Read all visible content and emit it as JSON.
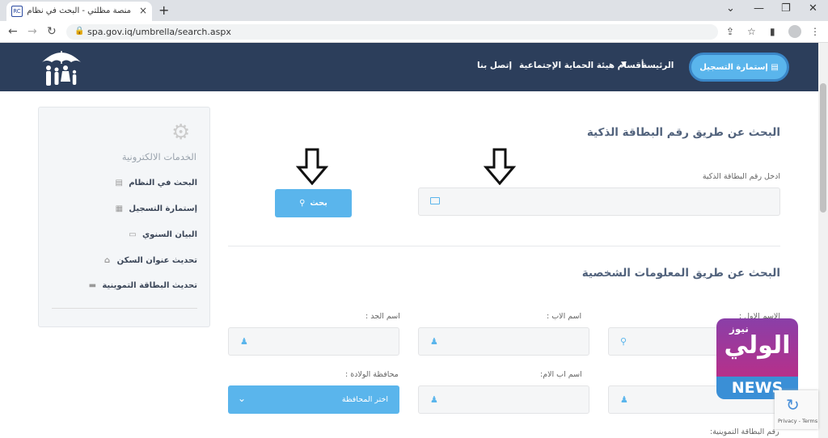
{
  "browser": {
    "tab_title": "منصة مظلتي - البحث في نظام هيئة الحماية",
    "tab_favicon_text": "RC",
    "tab_close": "×",
    "new_tab": "+",
    "url": "spa.gov.iq/umbrella/search.aspx",
    "window_controls": [
      "⌄",
      "—",
      "❐",
      "✕"
    ]
  },
  "header": {
    "menu": {
      "home": "الرئيسة",
      "departments": "أقسام هيئة الحماية الإجتماعية",
      "contact": "إتصل بنا"
    },
    "register_button": "إستمارة التسجيل"
  },
  "sidebar": {
    "title": "الخدمات الالكترونية",
    "items": [
      {
        "label": "البحث في النظام",
        "icon": "database-icon"
      },
      {
        "label": "إستمارة التسجيل",
        "icon": "file-icon"
      },
      {
        "label": "البيان السنوي",
        "icon": "id-card-icon"
      },
      {
        "label": "تحديث عنوان السكن",
        "icon": "home-icon"
      },
      {
        "label": "تحديث البطاقة التموينية",
        "icon": "credit-card-icon"
      }
    ]
  },
  "smart_card_search": {
    "heading": "البحث عن طريق رقم البطاقة الذكية",
    "input_label": "ادخل رقم البطاقة الذكية",
    "search_button": "بحث"
  },
  "personal_info_search": {
    "heading": "البحث عن طريق المعلومات الشخصية",
    "labels": {
      "first_name": "الاسم الاول :",
      "father_name": "اسم الاب :",
      "grandfather_name": "اسم الجد :",
      "mother_father_name": "اسم اب الام:",
      "birth_governorate": "محافظة الولادة :",
      "ration_card": "رقم البطاقة التموينية:"
    },
    "governorate_select": "اختر المحافظة"
  },
  "watermark": {
    "arabic": "الولي",
    "arabic_small": "نيوز",
    "english": "NEWS"
  },
  "recaptcha": {
    "terms": "Privacy - Terms"
  },
  "colors": {
    "header_bg": "#2c3e5b",
    "accent": "#5ab5ec"
  }
}
